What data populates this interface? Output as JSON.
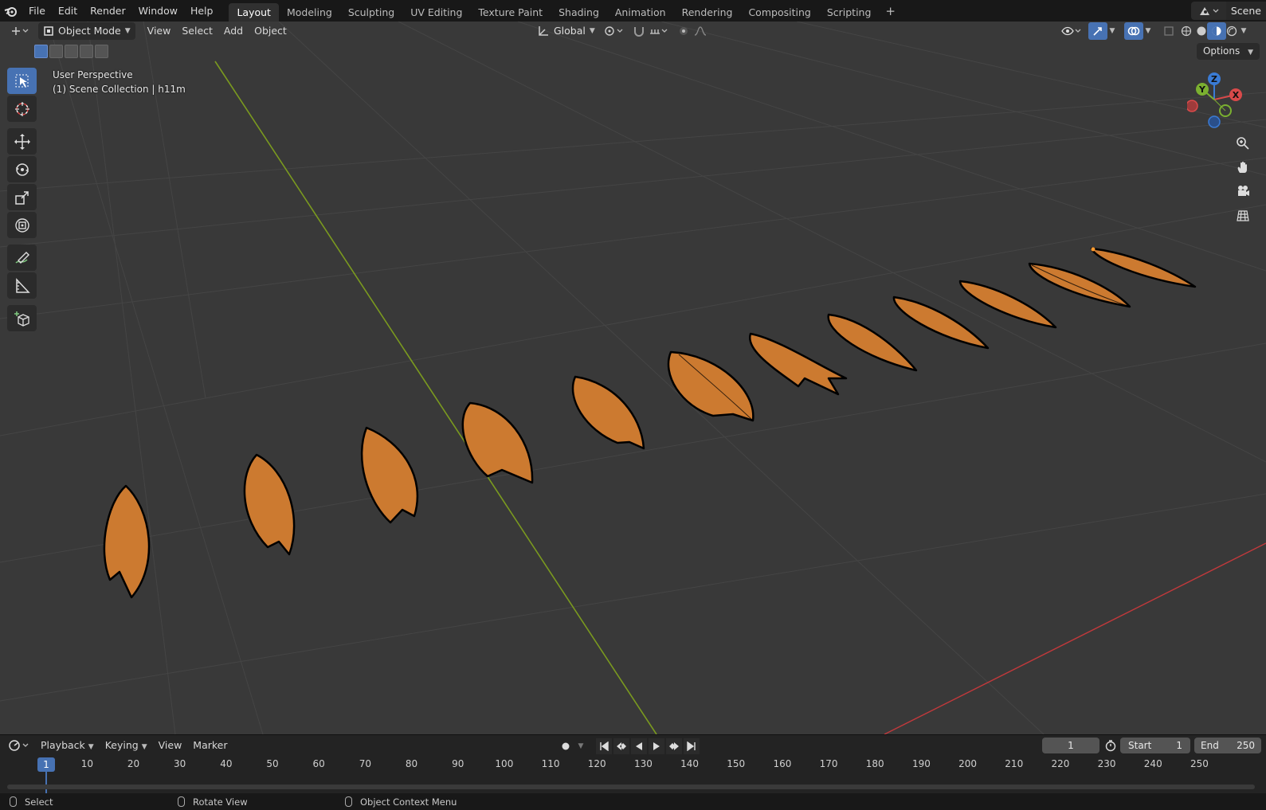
{
  "topbar": {
    "menus": [
      "File",
      "Edit",
      "Render",
      "Window",
      "Help"
    ],
    "workspaces": [
      "Layout",
      "Modeling",
      "Sculpting",
      "UV Editing",
      "Texture Paint",
      "Shading",
      "Animation",
      "Rendering",
      "Compositing",
      "Scripting"
    ],
    "active_workspace": "Layout",
    "add_label": "+",
    "scene_name": "Scene"
  },
  "viewport": {
    "header": {
      "mode": "Object Mode",
      "menus": [
        "View",
        "Select",
        "Add",
        "Object"
      ],
      "transform_orientation": "Global"
    },
    "options_label": "Options",
    "perspective_label": "User Perspective",
    "collection_label": "(1) Scene Collection | h11m",
    "object_color": "#cc7a30",
    "x_axis_color": "#c0393b",
    "y_axis_color": "#7a9a1f",
    "gizmo": {
      "z": "Z",
      "y": "Y",
      "x": "X"
    }
  },
  "timeline": {
    "menus": [
      "Playback",
      "Keying",
      "View",
      "Marker"
    ],
    "current_frame": "1",
    "start_label": "Start",
    "start_value": "1",
    "end_label": "End",
    "end_value": "250",
    "playhead": "1",
    "ticks": [
      "10",
      "20",
      "30",
      "40",
      "50",
      "60",
      "70",
      "80",
      "90",
      "100",
      "110",
      "120",
      "130",
      "140",
      "150",
      "160",
      "170",
      "180",
      "190",
      "200",
      "210",
      "220",
      "230",
      "240",
      "250"
    ]
  },
  "statusbar": {
    "select": "Select",
    "rotate": "Rotate View",
    "context": "Object Context Menu"
  }
}
